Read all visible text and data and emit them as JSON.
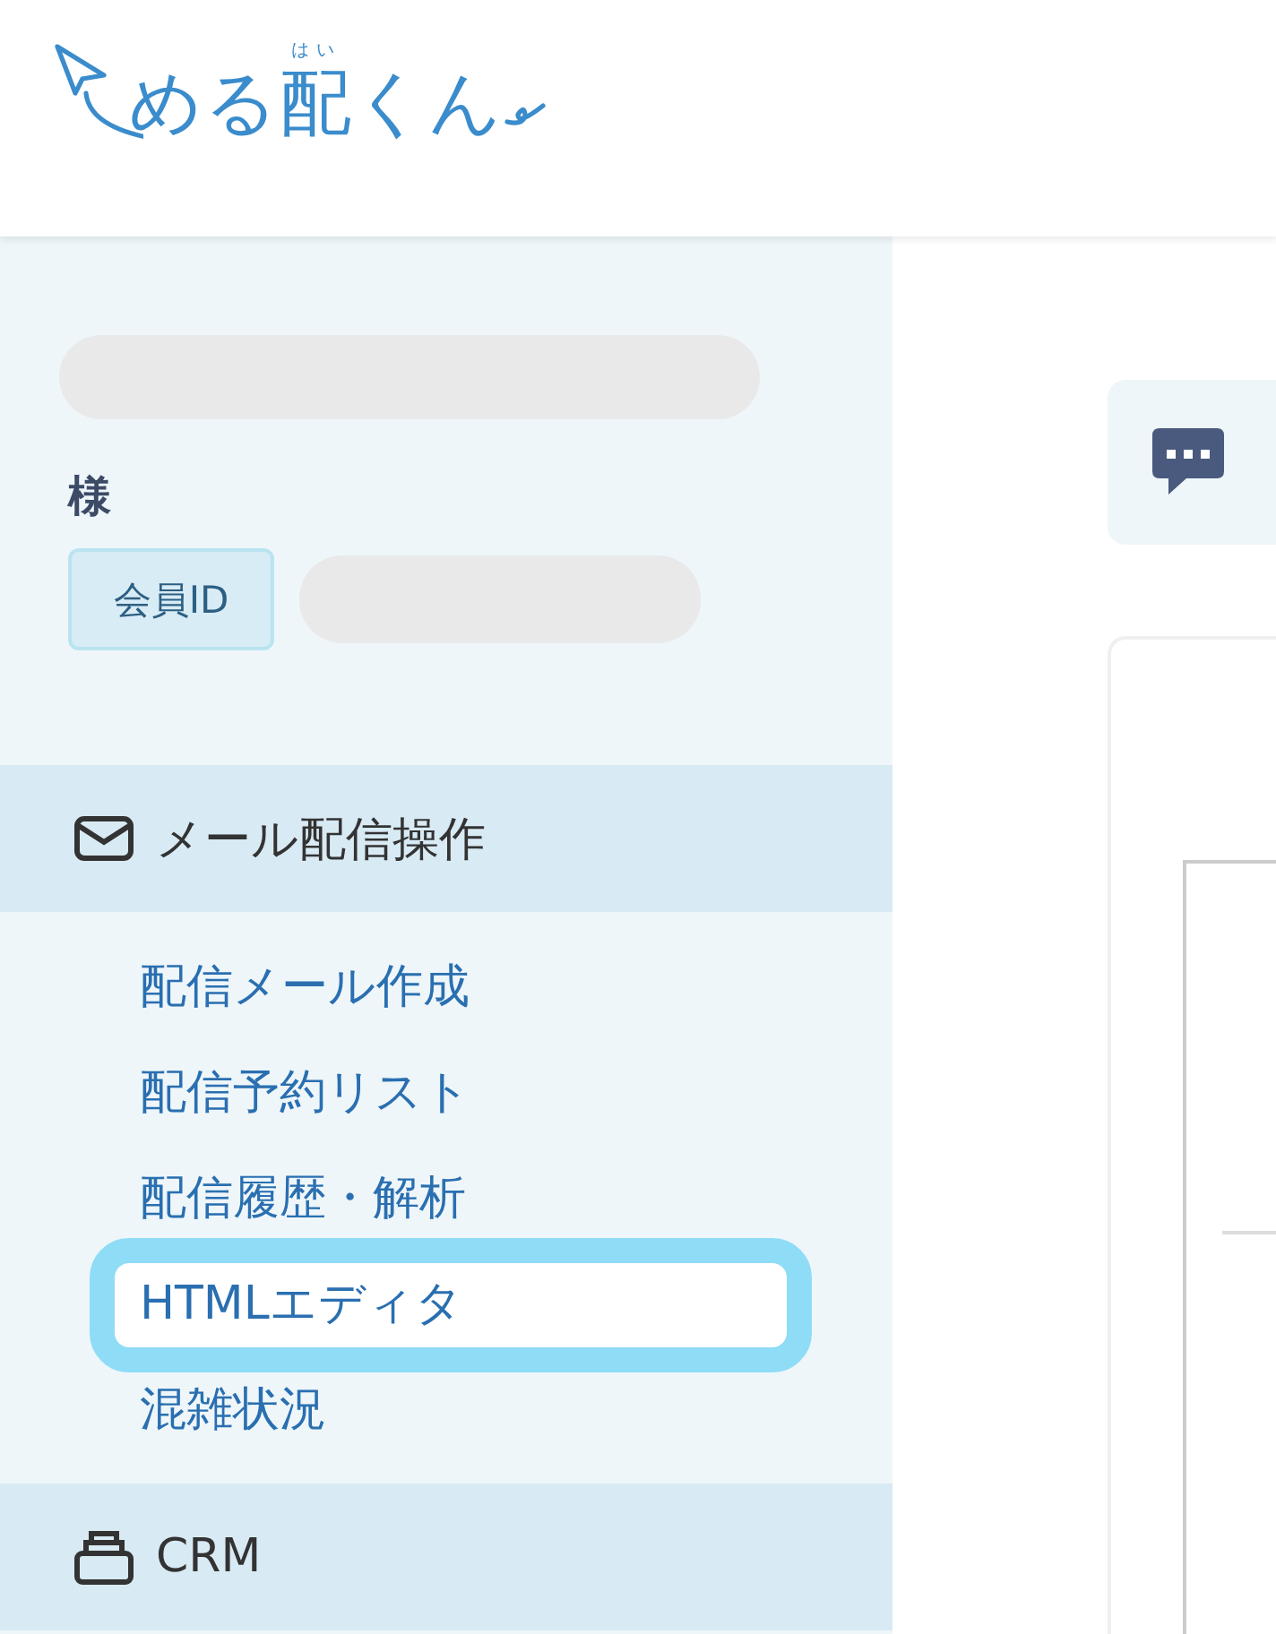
{
  "logo": {
    "parts": [
      {
        "text": "める"
      },
      {
        "text": "配",
        "ruby": "はい"
      },
      {
        "text": "くん"
      }
    ]
  },
  "account": {
    "honorific": "様",
    "member_id_label": "会員ID"
  },
  "menu": [
    {
      "label": "メール配信操作",
      "kind": "mail",
      "children": [
        {
          "label": "配信メール作成",
          "focused": false
        },
        {
          "label": "配信予約リスト",
          "focused": false
        },
        {
          "label": "配信履歴・解析",
          "focused": false
        },
        {
          "label": "HTMLエディタ",
          "focused": true
        },
        {
          "label": "混雑状況",
          "focused": false
        }
      ]
    },
    {
      "label": "CRM",
      "kind": "crm"
    }
  ]
}
